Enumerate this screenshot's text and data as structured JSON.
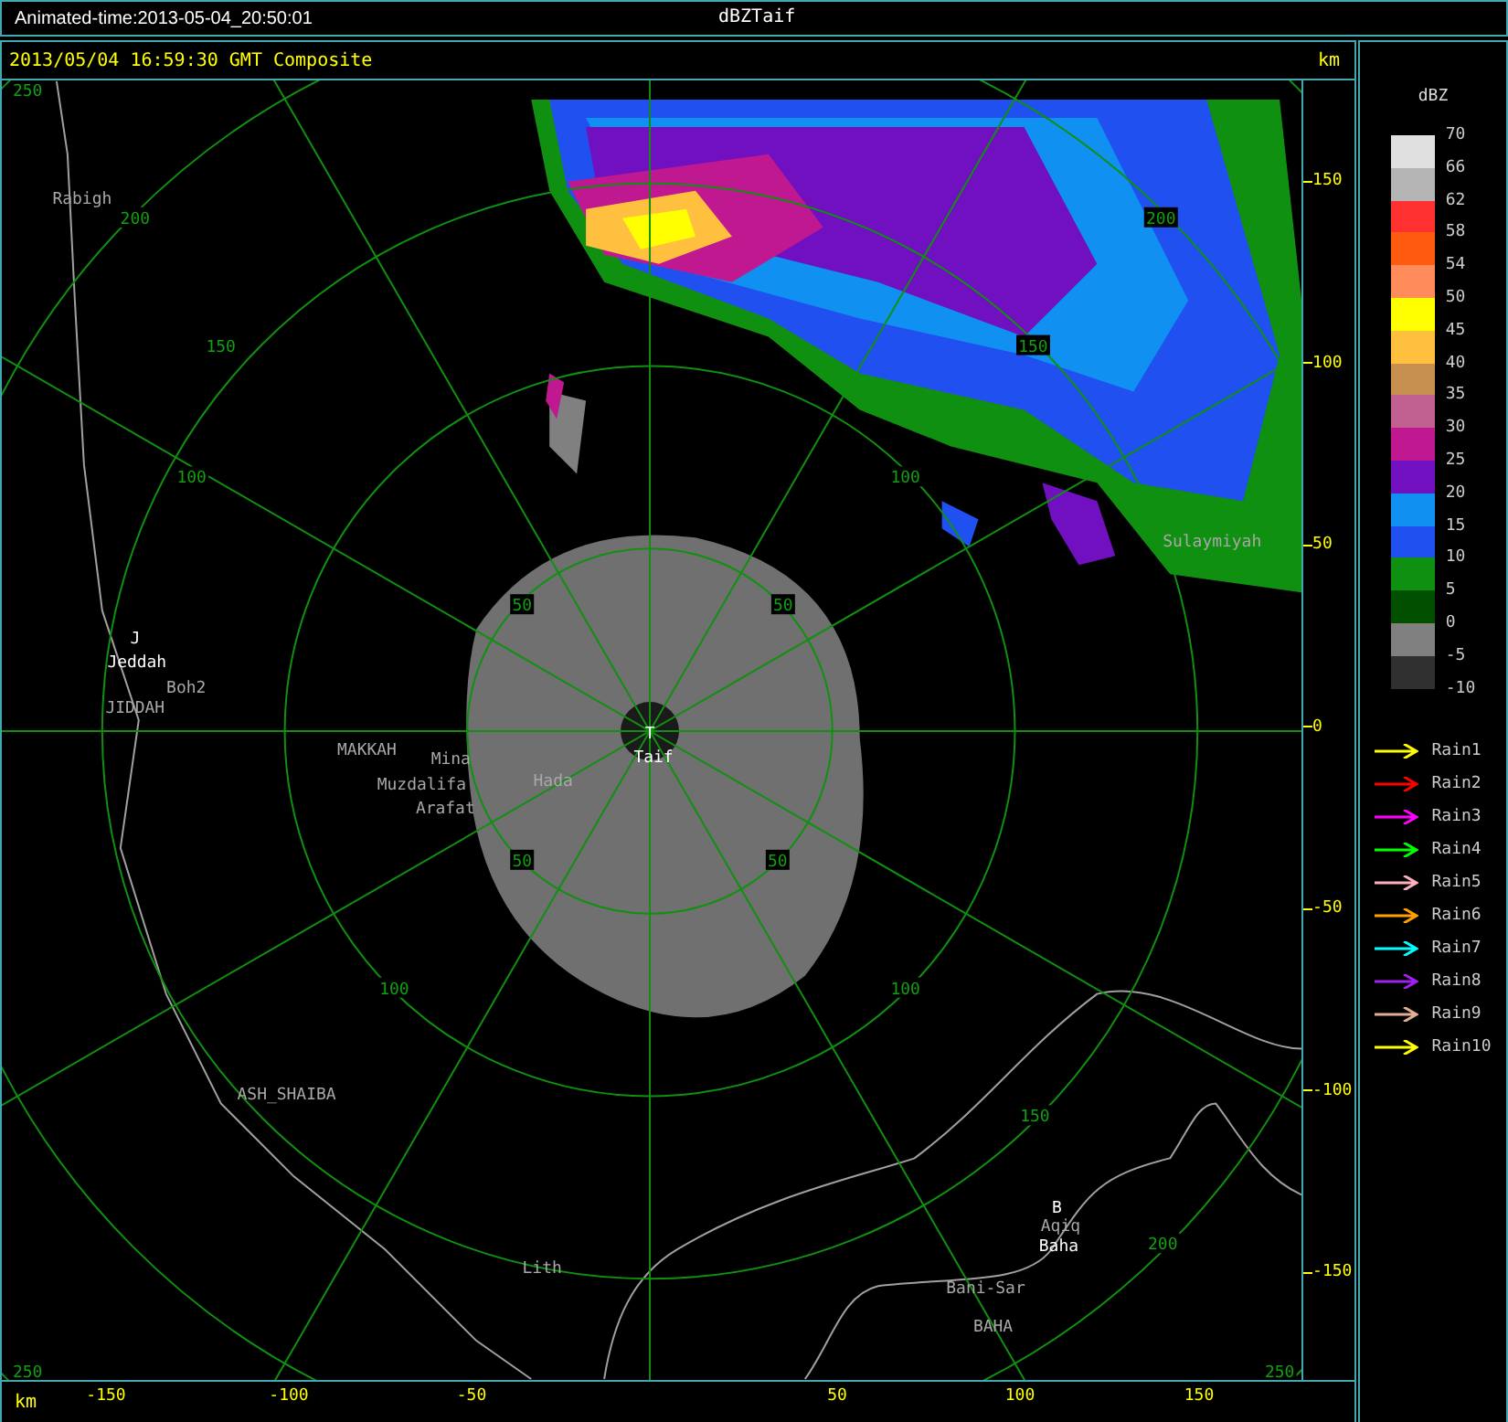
{
  "window": {
    "animated_time": "Animated-time:2013-05-04_20:50:01",
    "title": "dBZTaif"
  },
  "header": {
    "timestamp": "2013/05/04 16:59:30 GMT Composite",
    "unit": "km"
  },
  "map": {
    "ring_labels": [
      "250",
      "200",
      "150",
      "100",
      "200",
      "150",
      "100",
      "50",
      "50",
      "50",
      "50",
      "100",
      "100",
      "150",
      "200",
      "250",
      "250"
    ],
    "places": [
      {
        "name": "Rabigh",
        "kind": "minor"
      },
      {
        "name": "J",
        "kind": "major"
      },
      {
        "name": "Jeddah",
        "kind": "major"
      },
      {
        "name": "Boh2",
        "kind": "minor"
      },
      {
        "name": "JIDDAH",
        "kind": "minor"
      },
      {
        "name": "MAKKAH",
        "kind": "minor"
      },
      {
        "name": "Mina",
        "kind": "minor"
      },
      {
        "name": "Muzdalifa",
        "kind": "minor"
      },
      {
        "name": "Arafat",
        "kind": "minor"
      },
      {
        "name": "Hada",
        "kind": "minor"
      },
      {
        "name": "T",
        "kind": "major"
      },
      {
        "name": "Taif",
        "kind": "major"
      },
      {
        "name": "Sulaymiyah",
        "kind": "minor"
      },
      {
        "name": "ASH_SHAIBA",
        "kind": "minor"
      },
      {
        "name": "B",
        "kind": "major"
      },
      {
        "name": "Aqiq",
        "kind": "minor"
      },
      {
        "name": "Baha",
        "kind": "major"
      },
      {
        "name": "Lith",
        "kind": "minor"
      },
      {
        "name": "Bani-Sar",
        "kind": "minor"
      },
      {
        "name": "BAHA",
        "kind": "minor"
      }
    ]
  },
  "y_axis": {
    "ticks": [
      "150",
      "100",
      "50",
      "0",
      "-50",
      "-100",
      "-150"
    ]
  },
  "x_axis": {
    "unit": "km",
    "ticks": [
      "-150",
      "-100",
      "-50",
      "50",
      "100",
      "150"
    ]
  },
  "legend": {
    "title": "dBZ",
    "bands": [
      {
        "color": "#e0e0e0"
      },
      {
        "color": "#b4b4b4"
      },
      {
        "color": "#ff3030"
      },
      {
        "color": "#ff5a10"
      },
      {
        "color": "#ff8c5a"
      },
      {
        "color": "#ffff00"
      },
      {
        "color": "#ffc040"
      },
      {
        "color": "#c89050"
      },
      {
        "color": "#c06090"
      },
      {
        "color": "#c01890"
      },
      {
        "color": "#7010c0"
      },
      {
        "color": "#1090f0"
      },
      {
        "color": "#2050f0"
      },
      {
        "color": "#109010"
      },
      {
        "color": "#005000"
      },
      {
        "color": "#808080"
      },
      {
        "color": "#303030"
      }
    ],
    "labels": [
      "70",
      "66",
      "62",
      "58",
      "54",
      "50",
      "45",
      "40",
      "35",
      "30",
      "25",
      "20",
      "15",
      "10",
      "5",
      "0",
      "-5",
      "-10"
    ],
    "tracks": [
      {
        "label": "Rain1",
        "color": "#ffff00"
      },
      {
        "label": "Rain2",
        "color": "#ff0000"
      },
      {
        "label": "Rain3",
        "color": "#ff00ff"
      },
      {
        "label": "Rain4",
        "color": "#00ff00"
      },
      {
        "label": "Rain5",
        "color": "#ffb0c0"
      },
      {
        "label": "Rain6",
        "color": "#ffa000"
      },
      {
        "label": "Rain7",
        "color": "#00ffff"
      },
      {
        "label": "Rain8",
        "color": "#a020f0"
      },
      {
        "label": "Rain9",
        "color": "#e0b090"
      },
      {
        "label": "Rain10",
        "color": "#ffff00"
      }
    ]
  }
}
